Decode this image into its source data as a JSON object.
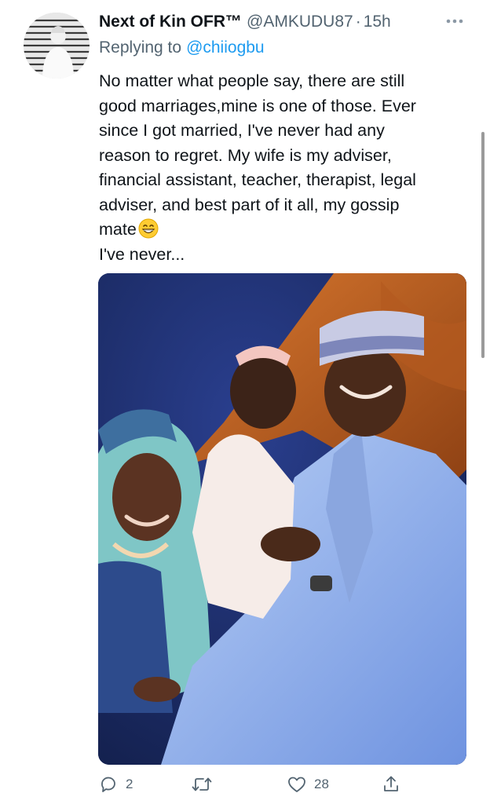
{
  "tweet": {
    "display_name": "Next of Kin OFR™",
    "handle": "@AMKUDU87",
    "separator": "·",
    "time": "15h",
    "reply_prefix": "Replying to",
    "reply_to": "@chiiogbu",
    "text_lines": [
      "No matter what people say, there are still",
      "good marriages,mine is one of those. Ever",
      "since I got married, I've never had any",
      "reason to regret. My wife is my adviser,",
      "financial assistant, teacher, therapist, legal",
      "adviser, and best part of it all, my gossip",
      "mate",
      "I've never..."
    ],
    "emoji": "grinning-face-with-smiling-eyes-icon"
  },
  "actions": {
    "reply_count": "2",
    "retweet_count": "",
    "like_count": "28",
    "share_count": ""
  },
  "colors": {
    "text_primary": "#0f1419",
    "text_secondary": "#536471",
    "link": "#1d9bf0"
  }
}
